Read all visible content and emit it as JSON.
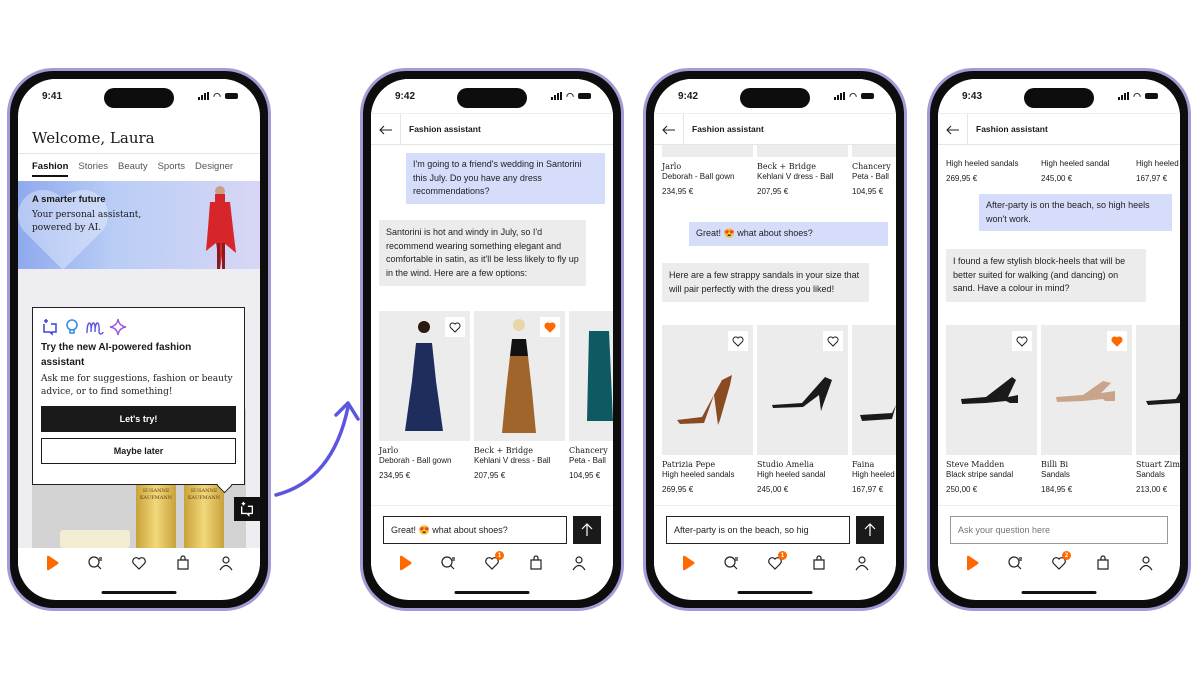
{
  "colors": {
    "accent": "#ff6900",
    "user_bubble": "#d5ddfb",
    "bot_bubble": "#ececec",
    "frame": "#a49ad6",
    "arrow": "#5b55e0"
  },
  "phones": [
    {
      "time": "9:41",
      "welcome": "Welcome, Laura",
      "categories": [
        "Fashion",
        "Stories",
        "Beauty",
        "Sports",
        "Designer"
      ],
      "hero": {
        "title": "A smarter future",
        "subtitle": "Your personal assistant, powered by AI."
      },
      "popover": {
        "title": "Try the new AI-powered fashion assistant",
        "body": "Ask me for suggestions, fashion or beauty advice, or to find something!",
        "primary": "Let's try!",
        "secondary": "Maybe later"
      },
      "bottles": [
        {
          "label": "SUSANNE KAUFMANN"
        },
        {
          "label": "SUSANNE KAUFMANN"
        }
      ],
      "tabbar": {
        "wishlist_badge": ""
      }
    },
    {
      "time": "9:42",
      "header": "Fashion assistant",
      "user_msg": "I'm going to a friend's wedding in Santorini this July. Do you have any dress recommendations?",
      "bot_msg": "Santorini is hot and windy in July, so I'd recommend wearing something elegant and comfortable in satin, as it'll be less likely to fly up in the wind. Here are a few options:",
      "products": [
        {
          "brand": "Jarlo",
          "name": "Deborah - Ball gown",
          "price": "234,95 €",
          "favorited": false
        },
        {
          "brand": "Beck + Bridge",
          "name": "Kehlani V dress - Ball",
          "price": "207,95 €",
          "favorited": true
        },
        {
          "brand": "Chancery",
          "name": "Peta - Ball",
          "price": "104,95 €",
          "favorited": false
        }
      ],
      "input_value": "Great! 😍 what about shoes?",
      "tabbar": {
        "wishlist_badge": "1"
      }
    },
    {
      "time": "9:42",
      "header": "Fashion assistant",
      "prev_products": [
        {
          "brand": "Jarlo",
          "name": "Deborah - Ball gown",
          "price": "234,95 €"
        },
        {
          "brand": "Beck + Bridge",
          "name": "Kehlani V dress - Ball",
          "price": "207,95 €"
        },
        {
          "brand": "Chancery",
          "name": "Peta - Ball",
          "price": "104,95 €"
        }
      ],
      "user_msg": "Great! 😍 what about shoes?",
      "bot_msg": "Here are a few strappy sandals in your size that will pair perfectly with the dress you liked!",
      "products": [
        {
          "brand": "Patrizia Pepe",
          "name": "High heeled sandals",
          "price": "269,95 €",
          "favorited": false
        },
        {
          "brand": "Studio Amelia",
          "name": "High heeled sandal",
          "price": "245,00 €",
          "favorited": false
        },
        {
          "brand": "Faina",
          "name": "High heeled",
          "price": "167,97 €",
          "favorited": false
        }
      ],
      "input_value": "After-party is on the beach, so hig",
      "tabbar": {
        "wishlist_badge": "1"
      }
    },
    {
      "time": "9:43",
      "header": "Fashion assistant",
      "prev_products": [
        {
          "name": "High heeled sandals",
          "price": "269,95 €"
        },
        {
          "name": "High heeled sandal",
          "price": "245,00 €"
        },
        {
          "name": "High heeled",
          "price": "167,97 €"
        }
      ],
      "user_msg": "After-party is on the beach, so high heels won't work.",
      "bot_msg": "I found a few stylish block-heels that will be better suited for walking (and dancing) on sand. Have a colour in mind?",
      "products": [
        {
          "brand": "Steve Madden",
          "name": "Black stripe sandal",
          "price": "250,00 €",
          "favorited": false
        },
        {
          "brand": "Billi Bi",
          "name": "Sandals",
          "price": "184,95 €",
          "favorited": true
        },
        {
          "brand": "Stuart Zim",
          "name": "Sandals",
          "price": "213,00 €",
          "favorited": false
        }
      ],
      "input_placeholder": "Ask your question here",
      "tabbar": {
        "wishlist_badge": "2"
      }
    }
  ]
}
